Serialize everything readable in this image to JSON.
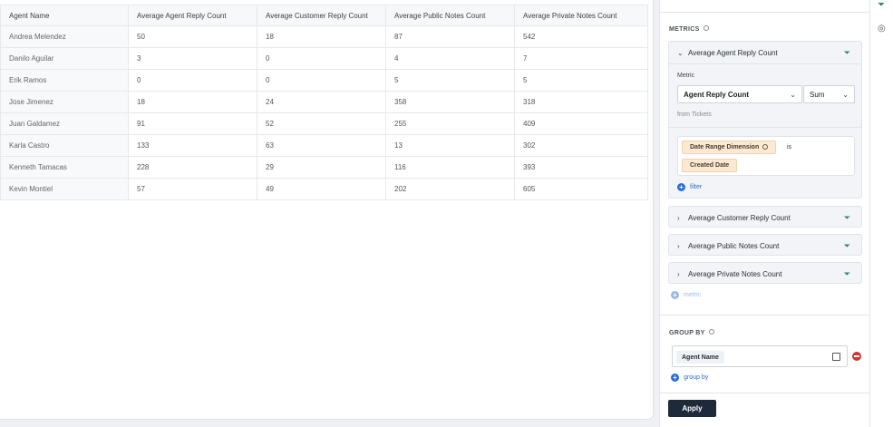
{
  "table": {
    "columns": [
      "Agent Name",
      "Average Agent Reply Count",
      "Average Customer Reply Count",
      "Average Public Notes Count",
      "Average Private Notes Count"
    ],
    "rows": [
      [
        "Andrea Melendez",
        "50",
        "18",
        "87",
        "542"
      ],
      [
        "Danilo Aguilar",
        "3",
        "0",
        "4",
        "7"
      ],
      [
        "Erik Ramos",
        "0",
        "0",
        "5",
        "5"
      ],
      [
        "Jose Jimenez",
        "18",
        "24",
        "358",
        "318"
      ],
      [
        "Juan Galdamez",
        "91",
        "52",
        "255",
        "409"
      ],
      [
        "Karla Castro",
        "133",
        "63",
        "13",
        "302"
      ],
      [
        "Kenneth Tamacas",
        "228",
        "29",
        "116",
        "393"
      ],
      [
        "Kevin Montiel",
        "57",
        "49",
        "202",
        "605"
      ]
    ]
  },
  "panel": {
    "metrics_title": "METRICS",
    "metrics": [
      {
        "label": "Average Agent Reply Count",
        "expanded": true,
        "metric_label": "Metric",
        "metric_value": "Agent Reply Count",
        "aggregation": "Sum",
        "source": "from Tickets",
        "filter_dimension": "Date Range Dimension",
        "filter_operator": "is",
        "filter_value": "Created Date",
        "add_filter_label": "filter"
      },
      {
        "label": "Average Customer Reply Count",
        "expanded": false
      },
      {
        "label": "Average Public Notes Count",
        "expanded": false
      },
      {
        "label": "Average Private Notes Count",
        "expanded": false
      }
    ],
    "add_metric_label": "metric",
    "group_by_title": "GROUP BY",
    "group_by_value": "Agent Name",
    "add_group_by_label": "group by",
    "apply_label": "Apply"
  },
  "icons": {
    "metric_funnel": "funnel-icon",
    "sidebar_top": "funnel-icon",
    "sidebar_second": "palette-icon"
  },
  "colors": {
    "accent_blue": "#2a6fd6",
    "funnel_green": "#2a8a63",
    "filter_chip": "#fbe9d3",
    "remove_red": "#d93030",
    "apply_bg": "#1e2a3a"
  }
}
